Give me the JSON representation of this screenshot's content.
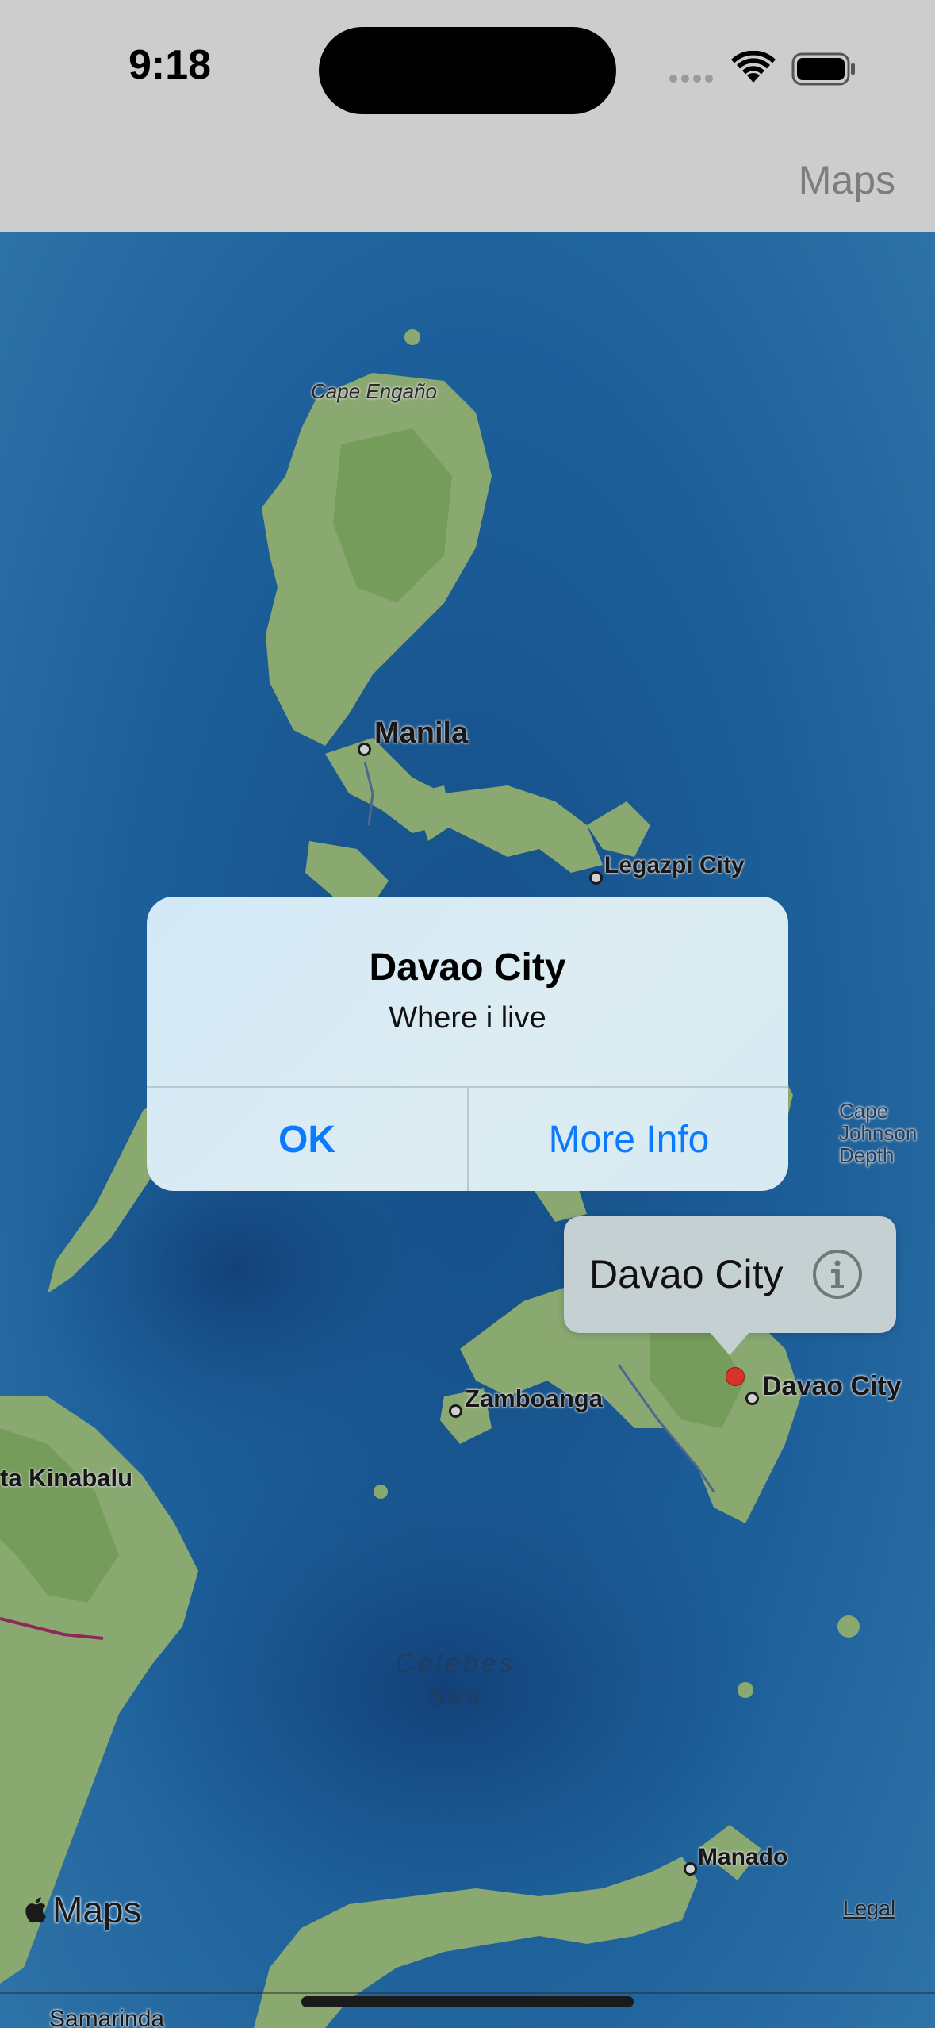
{
  "status_bar": {
    "time": "9:18",
    "icons": [
      "signal-icon",
      "wifi-icon",
      "battery-icon"
    ]
  },
  "nav": {
    "maps_link": "Maps"
  },
  "map": {
    "labels": {
      "cape_engano": "Cape Engaño",
      "manila": "Manila",
      "legazpi": "Legazpi City",
      "cape_johnson": "Cape Johnson Depth",
      "davao": "Davao City",
      "zamboanga": "Zamboanga",
      "kota_kinabalu": "ta Kinabalu",
      "celebes_sea": "Celebes Sea",
      "manado": "Manado",
      "samarinda": "Samarinda"
    },
    "attribution": "Maps",
    "legal": "Legal"
  },
  "alert": {
    "title": "Davao City",
    "message": "Where i live",
    "ok_label": "OK",
    "more_info_label": "More Info"
  },
  "callout": {
    "title": "Davao City",
    "icon": "info-icon"
  },
  "colors": {
    "accent": "#0a7aff",
    "pin": "#d9322b",
    "land": "#a9cf8a",
    "ocean": "#1f6fb3"
  }
}
